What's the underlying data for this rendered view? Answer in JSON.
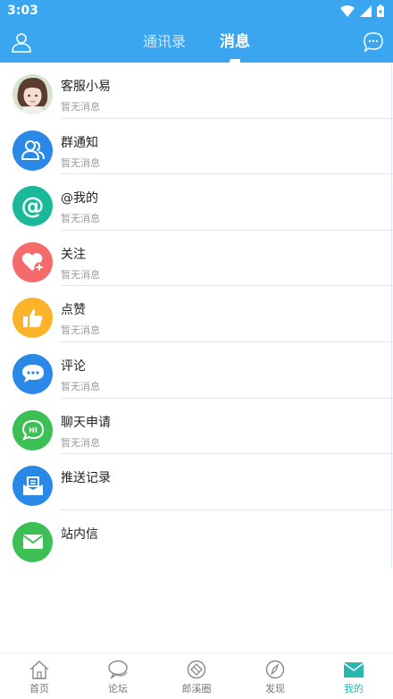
{
  "status_bar": {
    "time": "3:03"
  },
  "header": {
    "tabs": [
      {
        "label": "通讯录",
        "active": false
      },
      {
        "label": "消息",
        "active": true
      }
    ]
  },
  "messages": [
    {
      "title": "客服小易",
      "subtitle": "暂无消息",
      "icon": "customer-service-avatar",
      "color": "#e8d6c8"
    },
    {
      "title": "群通知",
      "subtitle": "暂无消息",
      "icon": "group-icon",
      "color": "#2a88e6"
    },
    {
      "title": "@我的",
      "subtitle": "暂无消息",
      "icon": "at-icon",
      "color": "#19b99a"
    },
    {
      "title": "关注",
      "subtitle": "暂无消息",
      "icon": "heart-plus-icon",
      "color": "#f56b6b"
    },
    {
      "title": "点赞",
      "subtitle": "暂无消息",
      "icon": "thumbs-up-icon",
      "color": "#fbb42a"
    },
    {
      "title": "评论",
      "subtitle": "暂无消息",
      "icon": "comment-icon",
      "color": "#2a88e6"
    },
    {
      "title": "聊天申请",
      "subtitle": "暂无消息",
      "icon": "chat-request-icon",
      "color": "#3cbf55"
    },
    {
      "title": "推送记录",
      "subtitle": "",
      "icon": "push-record-icon",
      "color": "#2a88e6"
    },
    {
      "title": "站内信",
      "subtitle": "",
      "icon": "mail-icon",
      "color": "#3cbf55"
    }
  ],
  "bottom_nav": [
    {
      "label": "首页",
      "icon": "home-icon",
      "active": false
    },
    {
      "label": "论坛",
      "icon": "forum-icon",
      "active": false
    },
    {
      "label": "郎溪圈",
      "icon": "circle-icon",
      "active": false
    },
    {
      "label": "发现",
      "icon": "discover-icon",
      "active": false
    },
    {
      "label": "我的",
      "icon": "mine-icon",
      "active": true
    }
  ],
  "colors": {
    "primary": "#3aa6f0",
    "accent": "#2cb6b0"
  }
}
